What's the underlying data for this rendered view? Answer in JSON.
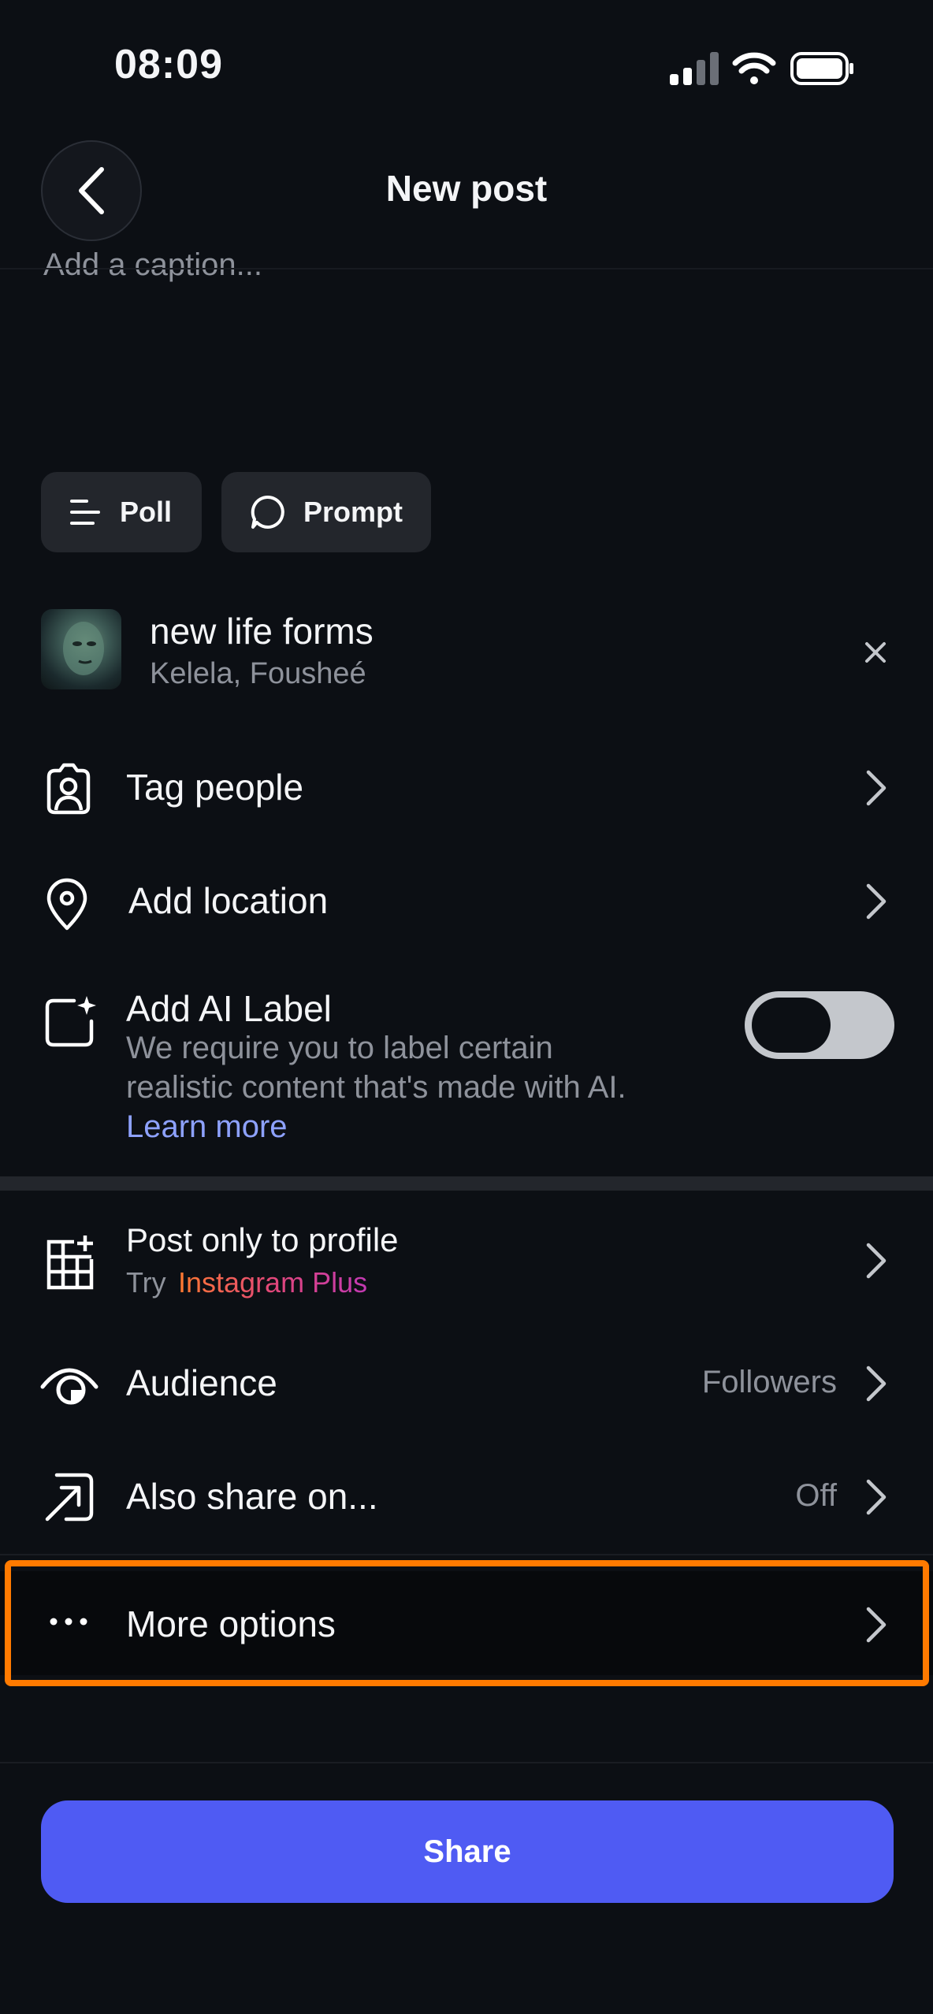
{
  "status_bar": {
    "time": "08:09"
  },
  "header": {
    "title": "New post"
  },
  "caption": {
    "placeholder": "Add a caption..."
  },
  "chips": [
    {
      "label": "Poll",
      "icon": "list-icon"
    },
    {
      "label": "Prompt",
      "icon": "speech-bubble-icon"
    }
  ],
  "music": {
    "title": "new life forms",
    "artists": "Kelela, Fousheé"
  },
  "rows": {
    "tag_people": "Tag people",
    "add_location": "Add location",
    "ai_label": {
      "title": "Add AI Label",
      "description_line1": "We require you to label certain",
      "description_line2": "realistic content that's made with AI.",
      "link": "Learn more",
      "toggle_on": false
    },
    "post_only_profile": {
      "title": "Post only to profile",
      "try_prefix": "Try",
      "plus": "Instagram Plus"
    },
    "audience": {
      "label": "Audience",
      "value": "Followers"
    },
    "also_share": {
      "label": "Also share on...",
      "value": "Off"
    },
    "more_options": "More options"
  },
  "share_button": "Share",
  "colors": {
    "accent": "#4f5bf3",
    "link": "#8ea2ff",
    "highlight": "#ff7a00"
  }
}
